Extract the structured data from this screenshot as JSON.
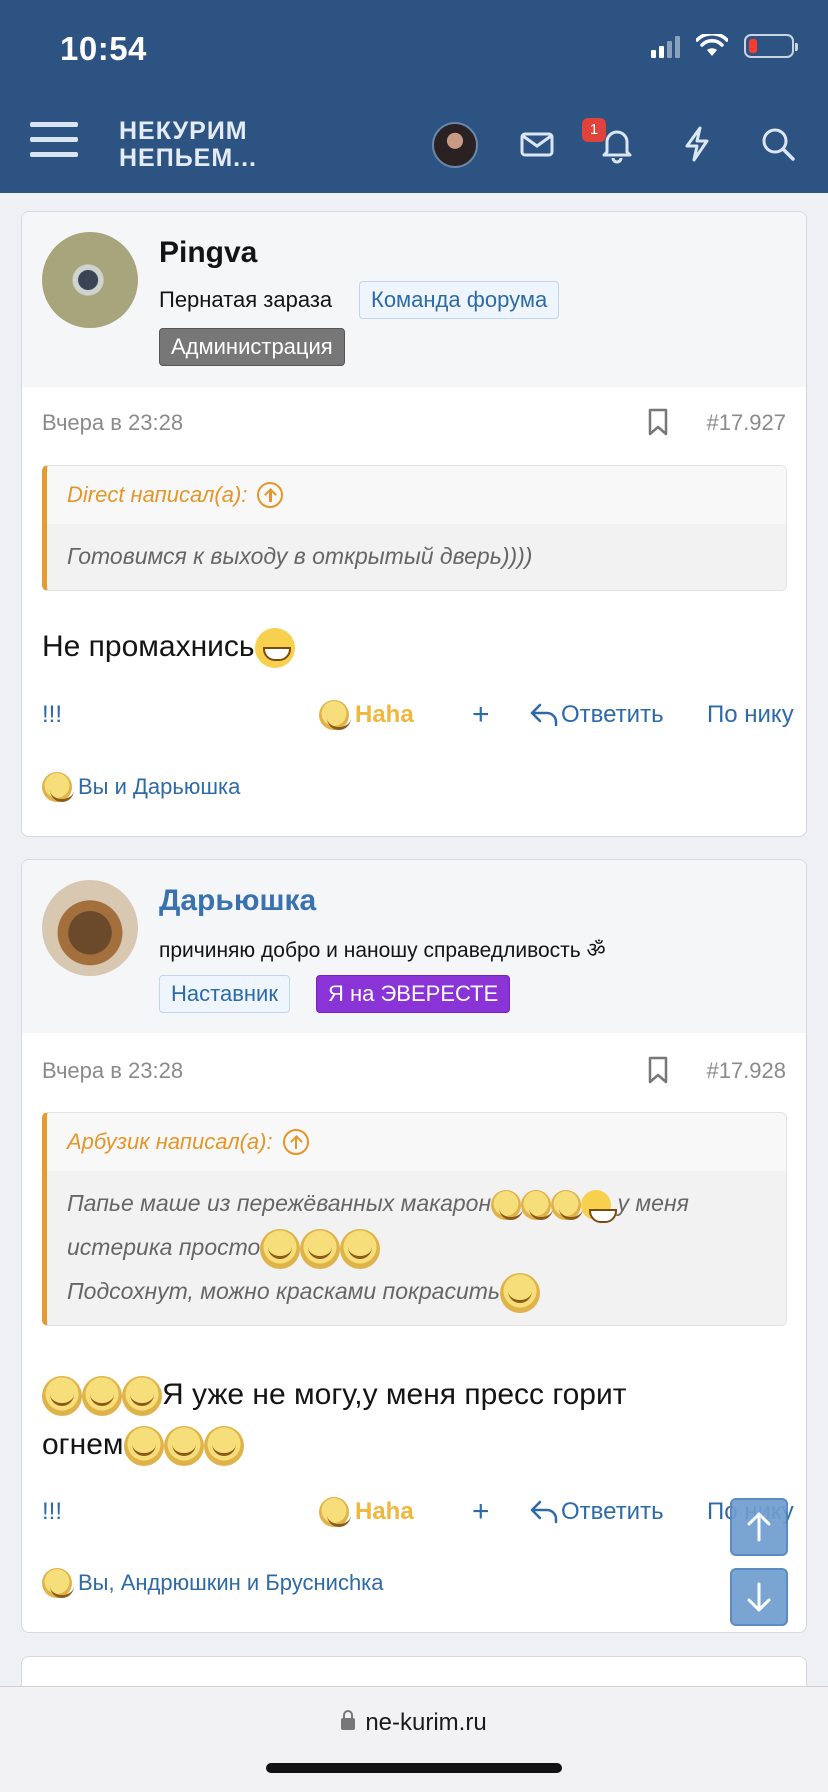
{
  "status_bar": {
    "time": "10:54"
  },
  "header": {
    "logo_line1": "НЕКУРИМ",
    "logo_line2": "НЕПЬЕМ...",
    "notification_count": "1",
    "icons": [
      "menu-icon",
      "avatar",
      "mail-icon",
      "bell-icon",
      "lightning-icon",
      "search-icon"
    ]
  },
  "posts": [
    {
      "username": "Pingva",
      "user_title": "Пернатая зараза",
      "badges": [
        "Команда форума",
        "Администрация"
      ],
      "date": "Вчера в 23:28",
      "post_number": "#17.927",
      "quote_author": "Direct написал(а):",
      "quote_lines": [
        "Готовимся к выходу в открытый дверь))))"
      ],
      "message": "Не промахнись",
      "actions": {
        "more": "!!!",
        "reaction": "Haha",
        "plus": "+",
        "reply": "Ответить",
        "by_nick": "По нику"
      },
      "reactions": "Вы и Дарьюшка"
    },
    {
      "username": "Дарьюшка",
      "user_title": "причиняю добро и наношу справедливость ॐ",
      "badges": [
        "Наставник",
        "Я на ЭВЕРЕСТЕ"
      ],
      "date": "Вчера в 23:28",
      "post_number": "#17.928",
      "quote_author": "Арбузик написал(а):",
      "quote_lines": [
        "Папье маше из пережёванных макарон",
        "у меня истерика просто",
        "Подсохнут, можно красками покрасить"
      ],
      "message_line1": "Я уже не могу,у меня пресс горит",
      "message_line2": "огнем",
      "actions": {
        "more": "!!!",
        "reaction": "Haha",
        "plus": "+",
        "reply": "Ответить",
        "by_nick": "По нику"
      },
      "reactions": "Вы, Андрюшкин и Бруснисhка"
    }
  ],
  "browser": {
    "url": "ne-kurim.ru"
  },
  "colors": {
    "header": "#2d5382",
    "link": "#2e6aa7",
    "quote_accent": "#e59b2f",
    "haha": "#f1b63a",
    "purple_badge": "#8a33d6"
  }
}
